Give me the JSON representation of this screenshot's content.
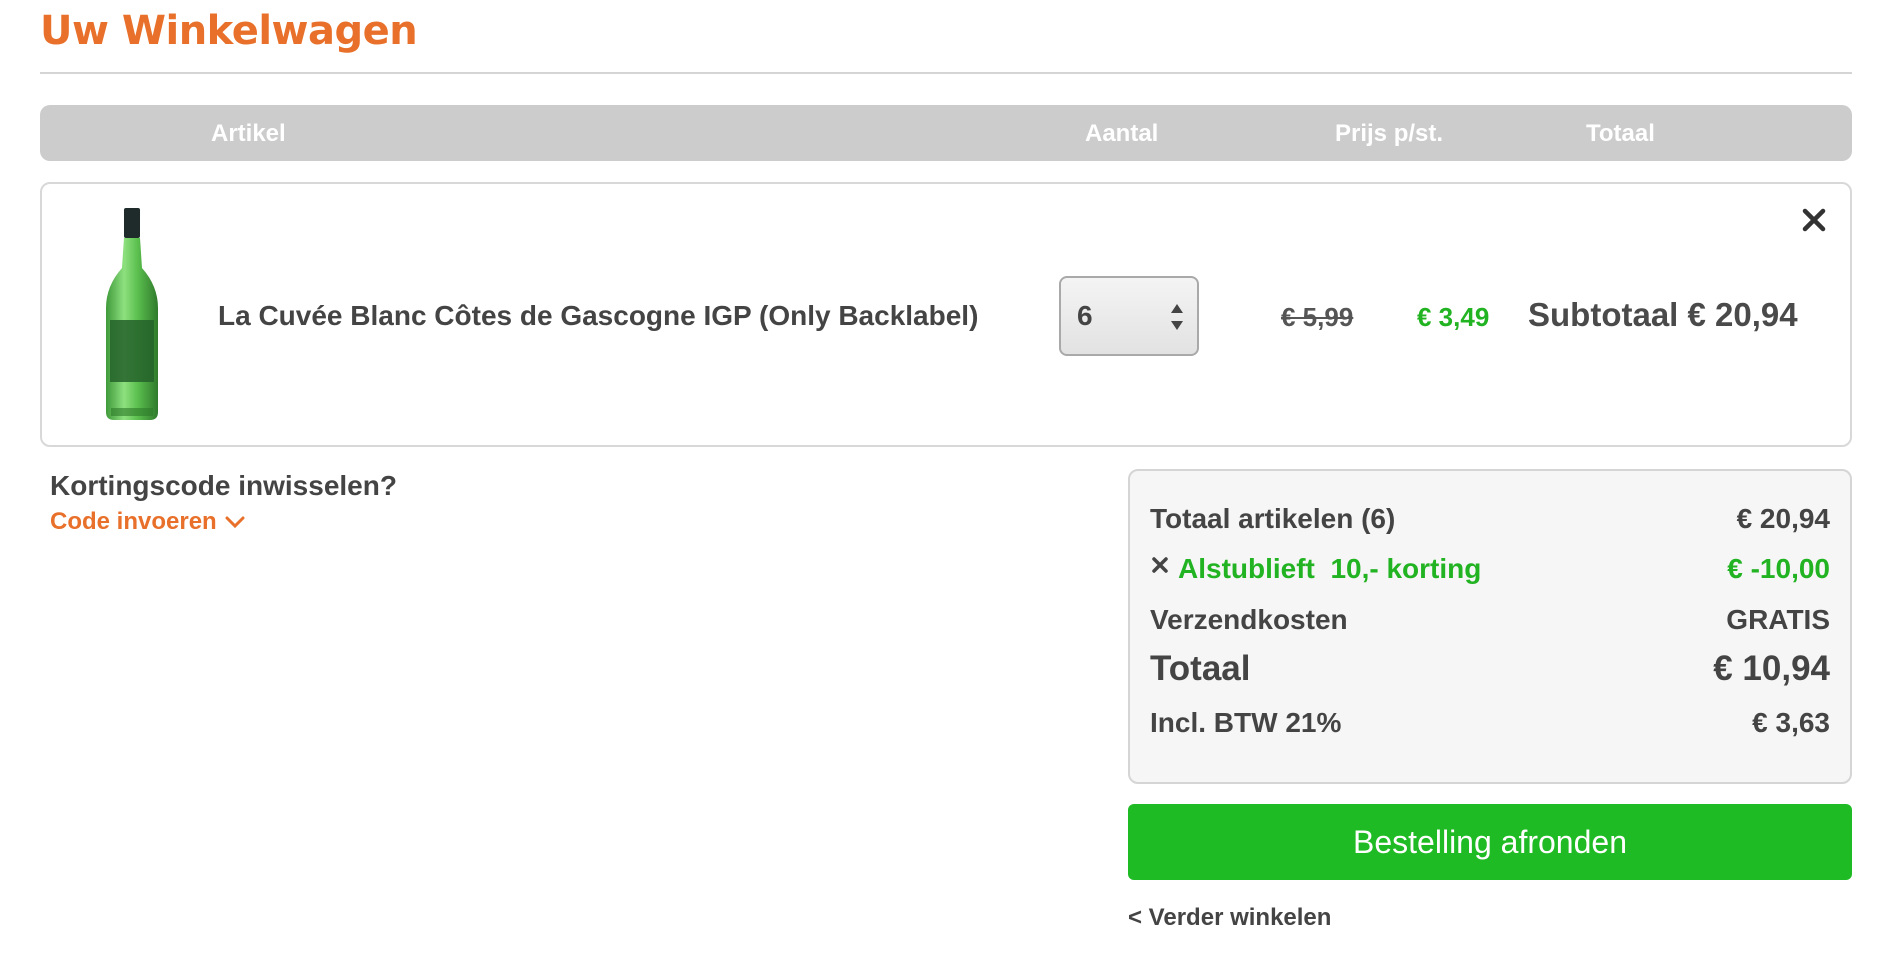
{
  "page": {
    "title": "Uw Winkelwagen"
  },
  "table_header": {
    "artikel": "Artikel",
    "aantal": "Aantal",
    "prijs": "Prijs p/st.",
    "totaal": "Totaal"
  },
  "cart_items": [
    {
      "name": "La Cuvée Blanc Côtes de Gascogne IGP (Only Backlabel)",
      "quantity": "6",
      "old_price": "€ 5,99",
      "new_price": "€ 3,49",
      "subtotal": "Subtotaal € 20,94",
      "image": "green-wine-bottle"
    }
  ],
  "coupon": {
    "question": "Kortingscode inwisselen?",
    "link": "Code invoeren"
  },
  "summary": {
    "items_label": "Totaal artikelen (6)",
    "items_value": "€ 20,94",
    "discount_label": "Alstublieft  10,- korting",
    "discount_value": "€ -10,00",
    "shipping_label": "Verzendkosten",
    "shipping_value": "GRATIS",
    "total_label": "Totaal",
    "total_value": "€ 10,94",
    "vat_label": "Incl. BTW 21%",
    "vat_value": "€ 3,63"
  },
  "actions": {
    "checkout": "Bestelling afronden",
    "continue": "< Verder winkelen"
  },
  "colors": {
    "brand_orange": "#e8702a",
    "price_green": "#22b322",
    "button_green": "#1fbb24",
    "header_gray": "#cccccc"
  },
  "icons": [
    "close-icon",
    "select-arrows-icon",
    "chevron-down-icon",
    "remove-discount-icon"
  ]
}
